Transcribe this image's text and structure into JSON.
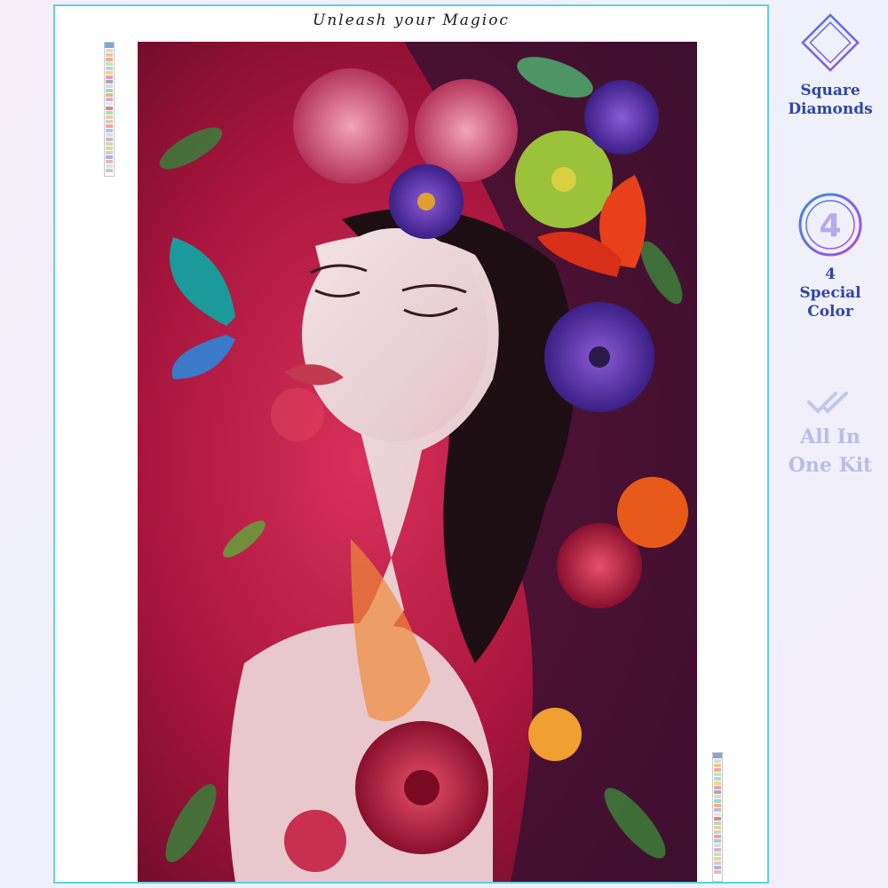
{
  "banner": {
    "title": "Unleash your Magioc"
  },
  "features": [
    {
      "label_line1": "Square",
      "label_line2": "Diamonds",
      "icon": "diamond-outline-icon"
    },
    {
      "number": "4",
      "label_line1": "4",
      "label_line2": "Special",
      "label_line3": "Color",
      "icon": "number-4-circle-icon"
    },
    {
      "label_line1": "All In",
      "label_line2": "One Kit",
      "icon": "double-check-icon"
    }
  ],
  "colors": {
    "frame_border": "#5fd0e6",
    "feature_text": "#2f46a8",
    "feature_faded": "#b9bde6",
    "painting_background": "#b0163f"
  }
}
